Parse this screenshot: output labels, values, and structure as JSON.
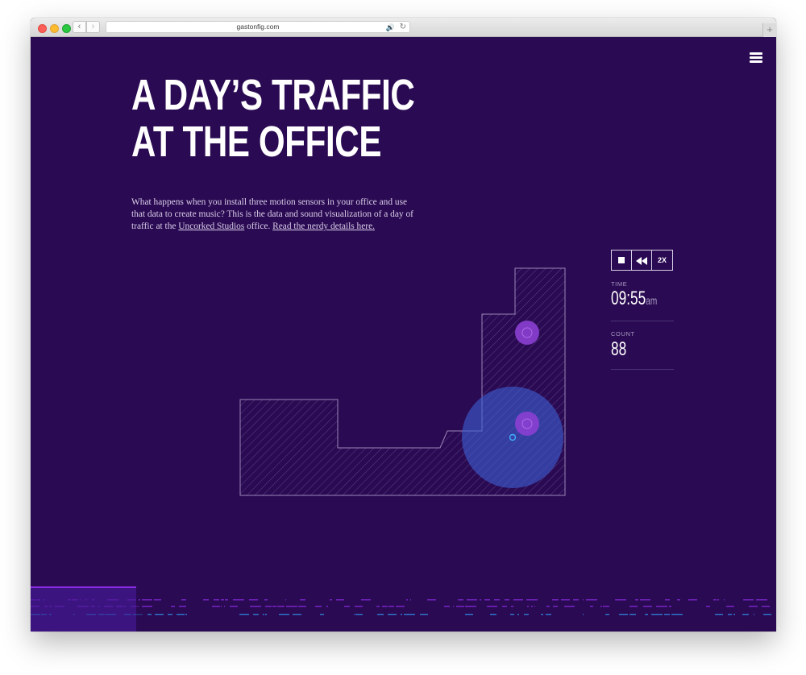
{
  "browser": {
    "url": "gastonfig.com",
    "back_glyph": "‹",
    "forward_glyph": "›",
    "reload_glyph": "↻",
    "speaker_glyph": "🔊",
    "new_tab_glyph": "+"
  },
  "page": {
    "title_line1": "A DAY’S TRAFFIC",
    "title_line2": "AT THE OFFICE",
    "intro": {
      "text_before_link1": "What happens when you install three motion sensors in your office and use that data to create music? This is the data and sound visualization of a day of traffic at the ",
      "link1": "Uncorked Studios",
      "text_between": " office. ",
      "link2": "Read the nerdy details here."
    }
  },
  "controls": {
    "speed_label": "2X",
    "time_label": "TIME",
    "time_value": "09:55",
    "time_ampm": "am",
    "count_label": "COUNT",
    "count_value": "88"
  },
  "icons": {
    "menu": "hamburger-icon",
    "stop": "stop-icon",
    "rewind": "rewind-icon"
  },
  "colors": {
    "background": "#2a0a52",
    "floorplan_stroke": "#9a86b8",
    "sensor_pink": "#8b3fd1",
    "sensor_blue": "#3b5fd0",
    "timeline_purple": "#8a2be2",
    "timeline_blue": "#2f8de8"
  }
}
